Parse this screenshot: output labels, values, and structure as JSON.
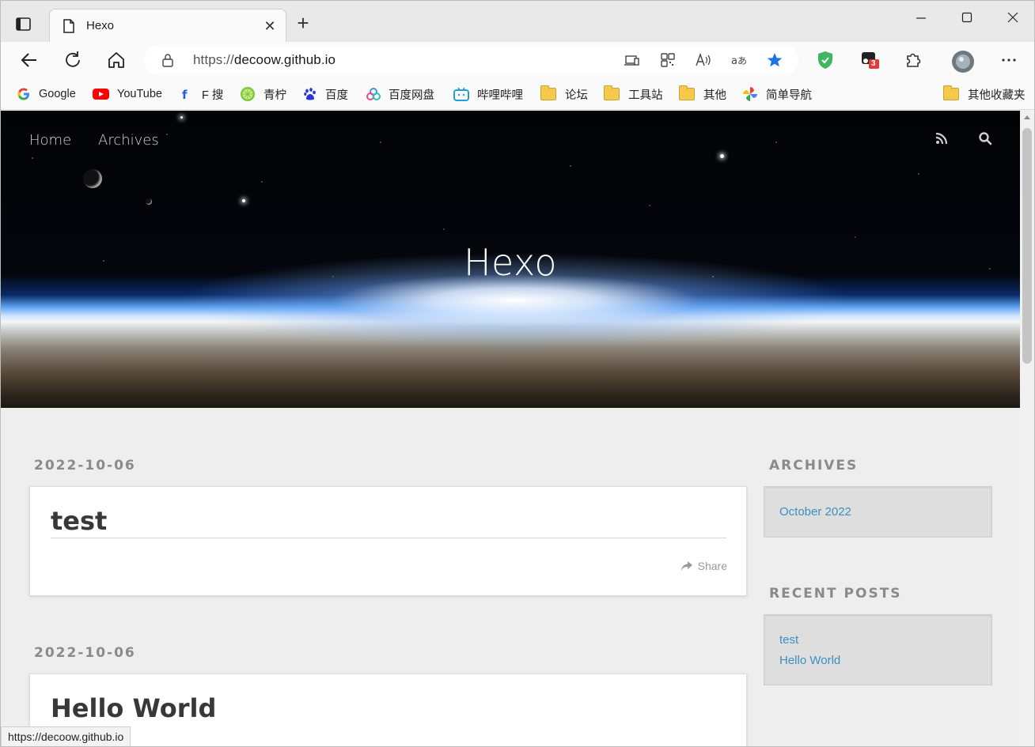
{
  "browser": {
    "tab_title": "Hexo",
    "tab_close": "✕",
    "new_tab": "+",
    "url_scheme": "https://",
    "url_host": "decoow.github.io",
    "extension_badge": "3",
    "status_url": "https://decoow.github.io"
  },
  "bookmarks": [
    {
      "label": "Google",
      "icon": "google-icon"
    },
    {
      "label": "YouTube",
      "icon": "youtube-icon"
    },
    {
      "label": "F 搜",
      "icon": "fsou-icon"
    },
    {
      "label": "青柠",
      "icon": "lime-icon"
    },
    {
      "label": "百度",
      "icon": "baidu-icon"
    },
    {
      "label": "百度网盘",
      "icon": "baidu-netdisk-icon"
    },
    {
      "label": "哔哩哔哩",
      "icon": "bilibili-icon"
    },
    {
      "label": "论坛",
      "icon": "folder-icon"
    },
    {
      "label": "工具站",
      "icon": "folder-icon"
    },
    {
      "label": "其他",
      "icon": "folder-icon"
    },
    {
      "label": "简单导航",
      "icon": "pinwheel-icon"
    }
  ],
  "other_bookmarks": "其他收藏夹",
  "site": {
    "nav": [
      "Home",
      "Archives"
    ],
    "title": "Hexo"
  },
  "posts": [
    {
      "date": "2022-10-06",
      "title": "test",
      "share": "Share"
    },
    {
      "date": "2022-10-06",
      "title": "Hello World"
    }
  ],
  "sidebar": {
    "archives_heading": "ARCHIVES",
    "archives": [
      "October 2022"
    ],
    "recent_heading": "RECENT POSTS",
    "recent": [
      "test",
      "Hello World"
    ]
  },
  "colors": {
    "link": "#3a8fc2",
    "accent": "#1a73e8"
  }
}
